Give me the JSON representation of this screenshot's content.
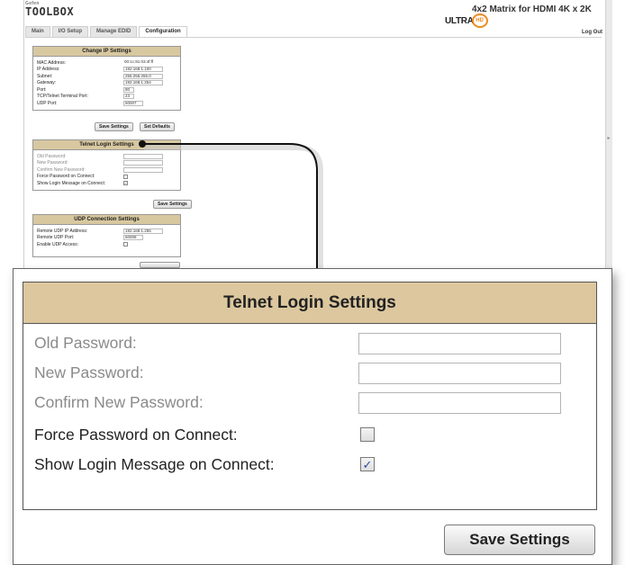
{
  "brand": {
    "top_text": "Gefen",
    "name": "TOOLBOX"
  },
  "header": {
    "product_title": "4x2 Matrix for HDMI 4K x 2K",
    "logo_ultra": "ULTRA",
    "logo_hd": "HD",
    "logout_label": "Log Out"
  },
  "tabs": [
    {
      "label": "Main"
    },
    {
      "label": "I/O Setup"
    },
    {
      "label": "Manage EDID"
    },
    {
      "label": "Configuration",
      "active": true
    }
  ],
  "ip_settings": {
    "title": "Change IP Settings",
    "fields": [
      {
        "label": "MAC Address:",
        "value": "00:1c:91:03:4f:ff"
      },
      {
        "label": "IP Address:",
        "value": "192.168.1.100"
      },
      {
        "label": "Subnet:",
        "value": "255.255.255.0"
      },
      {
        "label": "Gateway:",
        "value": "192.168.1.254"
      },
      {
        "label": "Port:",
        "value": "80"
      },
      {
        "label": "TCP/Telnet Terminal Port:",
        "value": "23"
      },
      {
        "label": "UDP Port:",
        "value": "50007"
      }
    ],
    "save_label": "Save Settings",
    "defaults_label": "Set Defaults"
  },
  "telnet_mini": {
    "title": "Telnet Login Settings",
    "old_password_label": "Old Password:",
    "new_password_label": "New Password:",
    "confirm_password_label": "Confirm New Password:",
    "force_password_label": "Force Password on Connect:",
    "show_message_label": "Show Login Message on Connect:",
    "save_label": "Save Settings"
  },
  "udp_settings": {
    "title": "UDP Connection Settings",
    "fields": [
      {
        "label": "Remote UDP IP Address:",
        "value": "192.168.1.255"
      },
      {
        "label": "Remote UDP Port:",
        "value": "50008"
      }
    ],
    "enable_label": "Enable UDP Access:"
  },
  "telnet_zoom": {
    "title": "Telnet Login Settings",
    "old_password_label": "Old Password:",
    "new_password_label": "New Password:",
    "confirm_password_label": "Confirm New Password:",
    "force_password_label": "Force Password on Connect:",
    "force_password_checked": false,
    "show_message_label": "Show Login Message on Connect:",
    "show_message_checked": true,
    "save_label": "Save Settings"
  }
}
